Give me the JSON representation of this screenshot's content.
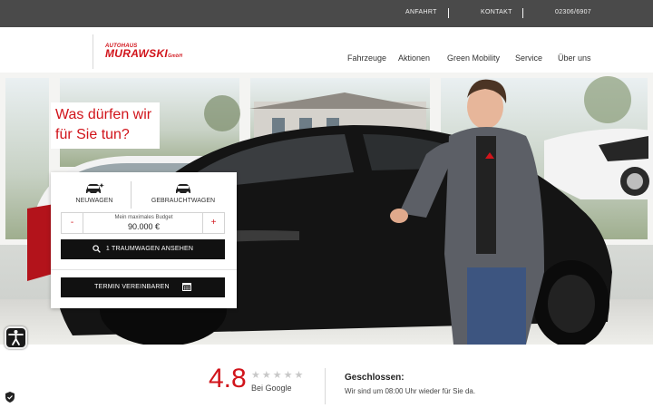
{
  "topbar": {
    "links": [
      "ANFAHRT",
      "KONTAKT",
      "02306/6907"
    ]
  },
  "logo": {
    "line1": "AUTOHAUS",
    "line2": "MURAWSKI",
    "suffix": "GmbH"
  },
  "nav": {
    "items": [
      "Fahrzeuge",
      "Aktionen",
      "Green Mobility",
      "Service",
      "Über uns"
    ]
  },
  "hero": {
    "headline_line1": "Was dürfen wir",
    "headline_line2": "für Sie tun?"
  },
  "finder": {
    "tabs": [
      {
        "label": "NEUWAGEN",
        "icon": "new-car-icon"
      },
      {
        "label": "GEBRAUCHTWAGEN",
        "icon": "used-car-icon"
      }
    ],
    "budget_label": "Mein maximales Budget",
    "budget_value": "90.000 €",
    "minus": "-",
    "plus": "+",
    "search_button": "1 TRAUMWAGEN ANSEHEN",
    "appointment_button": "TERMIN VEREINBAREN"
  },
  "rating": {
    "value": "4.8",
    "stars_total": 5,
    "stars_filled": 0,
    "source": "Bei Google"
  },
  "opening": {
    "title": "Geschlossen:",
    "text": "Wir sind um 08:00 Uhr wieder für Sie da."
  },
  "colors": {
    "brand_red": "#d1141b",
    "topbar": "#4a4a4a",
    "button": "#111111"
  }
}
